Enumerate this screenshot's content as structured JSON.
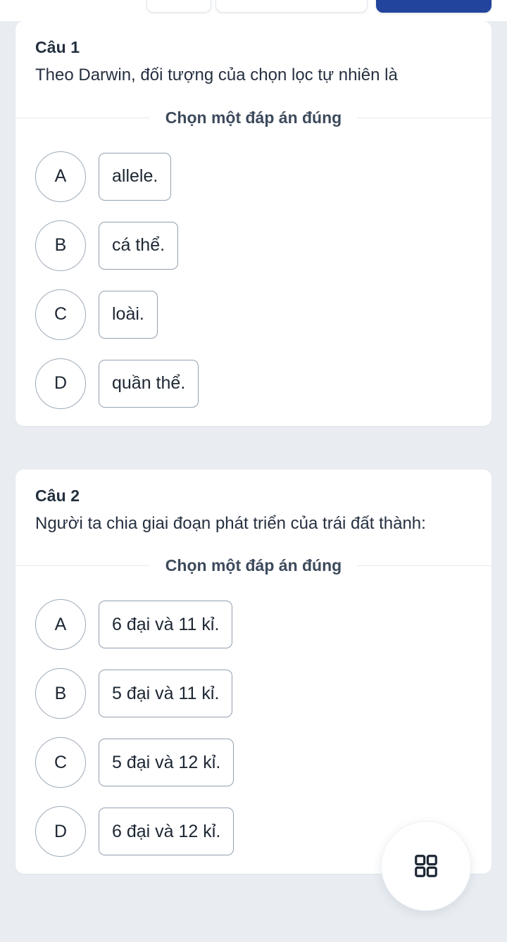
{
  "toolbar": {
    "chips": [
      {
        "name": "toolbar-chip-1",
        "label": ""
      },
      {
        "name": "toolbar-chip-2",
        "label": ""
      }
    ],
    "primary_button": {
      "label": "",
      "color": "#23449d"
    }
  },
  "theme": {
    "page_background": "#e9edf2",
    "card_background": "#ffffff",
    "text_color": "#222f3e",
    "outline_color": "#93a0ae",
    "accent": "#23449d"
  },
  "questions": [
    {
      "number_label": "Câu 1",
      "prompt": "Theo Darwin, đối tượng của chọn lọc tự nhiên là",
      "instruction": "Chọn một đáp án đúng",
      "options": [
        {
          "key": "A",
          "text": "allele."
        },
        {
          "key": "B",
          "text": "cá thể."
        },
        {
          "key": "C",
          "text": "loài."
        },
        {
          "key": "D",
          "text": "quần thể."
        }
      ]
    },
    {
      "number_label": "Câu 2",
      "prompt": "Người ta chia giai đoạn phát triển của trái đất thành:",
      "instruction": "Chọn một đáp án đúng",
      "options": [
        {
          "key": "A",
          "text": "6 đại và 11 kỉ."
        },
        {
          "key": "B",
          "text": "5 đại và 11 kỉ."
        },
        {
          "key": "C",
          "text": "5 đại và 12 kỉ."
        },
        {
          "key": "D",
          "text": "6 đại và 12 kỉ."
        }
      ]
    }
  ],
  "fab": {
    "icon": "grid-apps-icon",
    "label": ""
  }
}
